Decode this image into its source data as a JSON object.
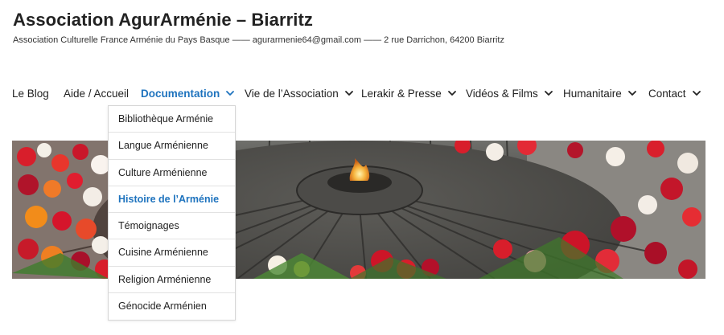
{
  "header": {
    "site_title": "Association AgurArménie – Biarritz",
    "site_description": "Association Culturelle France Arménie du Pays Basque —— agurarmenie64@gmail.com —— 2 rue Darrichon, 64200 Biarritz"
  },
  "nav": {
    "items": [
      {
        "label": "Le Blog"
      },
      {
        "label": "Aide / Accueil"
      },
      {
        "label": "Documentation"
      },
      {
        "label": "Vie de l’Association"
      },
      {
        "label": "Lerakir & Presse"
      },
      {
        "label": "Vidéos & Films"
      },
      {
        "label": "Humanitaire"
      },
      {
        "label": "Contact"
      }
    ],
    "active_index": 2
  },
  "dropdown": {
    "items": [
      {
        "label": "Bibliothèque Arménie"
      },
      {
        "label": "Langue Arménienne"
      },
      {
        "label": "Culture Arménienne"
      },
      {
        "label": "Histoire de l’Arménie"
      },
      {
        "label": "Témoignages"
      },
      {
        "label": "Cuisine Arménienne"
      },
      {
        "label": "Religion Arménienne"
      },
      {
        "label": "Génocide Arménien"
      }
    ],
    "active_index": 3
  },
  "colors": {
    "accent": "#1e73be",
    "text": "#222222"
  },
  "icons": {
    "chevron": "chevron-down-icon",
    "flame": "eternal-flame-icon"
  }
}
